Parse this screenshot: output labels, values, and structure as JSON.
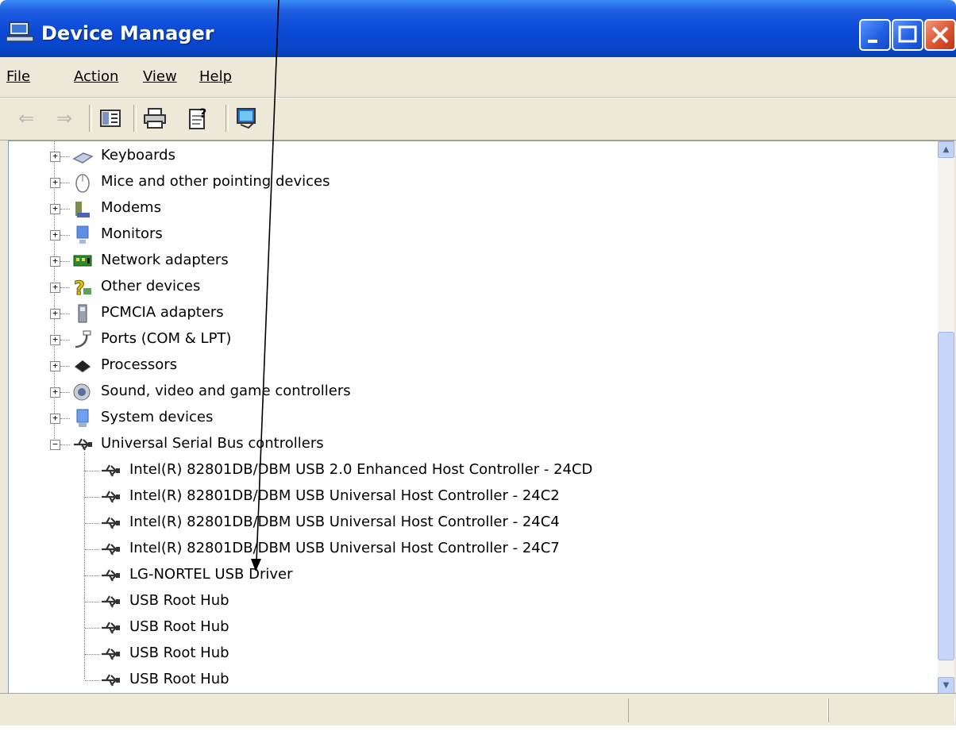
{
  "window": {
    "title": "Device Manager"
  },
  "menu": {
    "items": [
      "File",
      "Action",
      "View",
      "Help"
    ]
  },
  "toolbar": {
    "buttons": [
      "back-icon",
      "forward-icon",
      "show-hide-tree-icon",
      "print-icon",
      "properties-help-icon",
      "scan-hardware-icon"
    ]
  },
  "tree": {
    "categories": [
      {
        "label": "Keyboards",
        "icon": "keyboard-icon",
        "expanded": false
      },
      {
        "label": "Mice and other pointing devices",
        "icon": "mouse-icon",
        "expanded": false
      },
      {
        "label": "Modems",
        "icon": "modem-icon",
        "expanded": false
      },
      {
        "label": "Monitors",
        "icon": "monitor-icon",
        "expanded": false
      },
      {
        "label": "Network adapters",
        "icon": "network-adapter-icon",
        "expanded": false
      },
      {
        "label": "Other devices",
        "icon": "unknown-device-icon",
        "expanded": false
      },
      {
        "label": "PCMCIA adapters",
        "icon": "pcmcia-icon",
        "expanded": false
      },
      {
        "label": "Ports (COM & LPT)",
        "icon": "port-icon",
        "expanded": false
      },
      {
        "label": "Processors",
        "icon": "processor-icon",
        "expanded": false
      },
      {
        "label": "Sound, video and game controllers",
        "icon": "speaker-icon",
        "expanded": false
      },
      {
        "label": "System devices",
        "icon": "system-device-icon",
        "expanded": false
      },
      {
        "label": "Universal Serial Bus controllers",
        "icon": "usb-icon",
        "expanded": true
      }
    ],
    "usb_devices": [
      "Intel(R) 82801DB/DBM USB 2.0 Enhanced Host Controller - 24CD",
      "Intel(R) 82801DB/DBM USB Universal Host Controller - 24C2",
      "Intel(R) 82801DB/DBM USB Universal Host Controller - 24C4",
      "Intel(R) 82801DB/DBM USB Universal Host Controller - 24C7",
      "LG-NORTEL USB Driver",
      "USB Root Hub",
      "USB Root Hub",
      "USB Root Hub",
      "USB Root Hub"
    ]
  },
  "scrollbar": {
    "up": "▲",
    "down": "▼"
  },
  "colors": {
    "titlebar": "#0a48d6",
    "close": "#d8502e",
    "chrome": "#ece9d8"
  }
}
